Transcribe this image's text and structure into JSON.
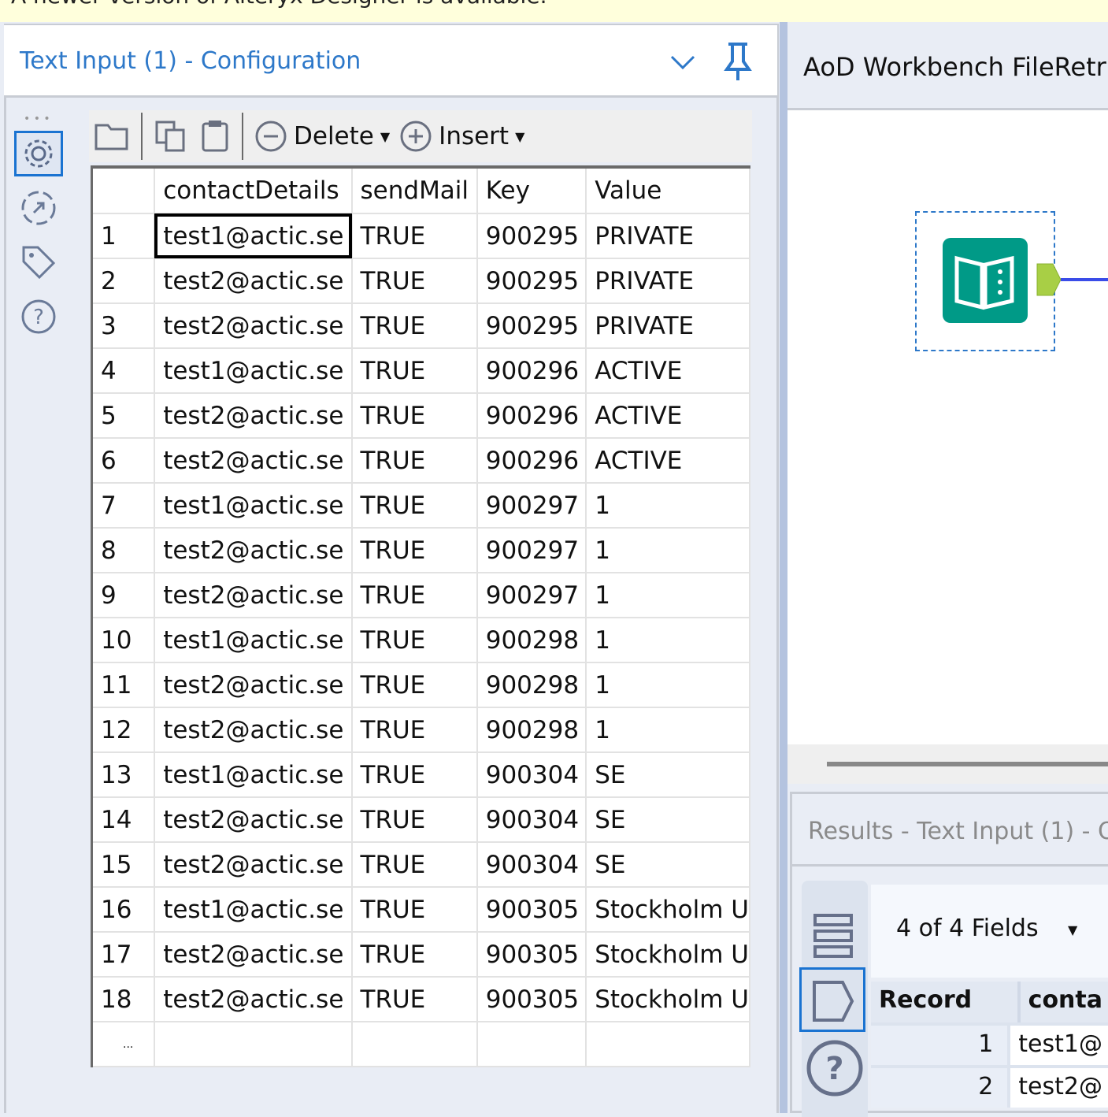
{
  "banner": {
    "text": "A newer version of Alteryx Designer is available."
  },
  "config": {
    "title": "Text Input (1) - Configuration",
    "toolbar": {
      "delete_label": "Delete",
      "insert_label": "Insert"
    },
    "columns": [
      "",
      "contactDetails",
      "sendMail",
      "Key",
      "Value"
    ],
    "rows": [
      [
        "1",
        "test1@actic.se",
        "TRUE",
        "900295",
        "PRIVATE"
      ],
      [
        "2",
        "test2@actic.se",
        "TRUE",
        "900295",
        "PRIVATE"
      ],
      [
        "3",
        "test2@actic.se",
        "TRUE",
        "900295",
        "PRIVATE"
      ],
      [
        "4",
        "test1@actic.se",
        "TRUE",
        "900296",
        "ACTIVE"
      ],
      [
        "5",
        "test2@actic.se",
        "TRUE",
        "900296",
        "ACTIVE"
      ],
      [
        "6",
        "test2@actic.se",
        "TRUE",
        "900296",
        "ACTIVE"
      ],
      [
        "7",
        "test1@actic.se",
        "TRUE",
        "900297",
        "1"
      ],
      [
        "8",
        "test2@actic.se",
        "TRUE",
        "900297",
        "1"
      ],
      [
        "9",
        "test2@actic.se",
        "TRUE",
        "900297",
        "1"
      ],
      [
        "10",
        "test1@actic.se",
        "TRUE",
        "900298",
        "1"
      ],
      [
        "11",
        "test2@actic.se",
        "TRUE",
        "900298",
        "1"
      ],
      [
        "12",
        "test2@actic.se",
        "TRUE",
        "900298",
        "1"
      ],
      [
        "13",
        "test1@actic.se",
        "TRUE",
        "900304",
        "SE"
      ],
      [
        "14",
        "test2@actic.se",
        "TRUE",
        "900304",
        "SE"
      ],
      [
        "15",
        "test2@actic.se",
        "TRUE",
        "900304",
        "SE"
      ],
      [
        "16",
        "test1@actic.se",
        "TRUE",
        "900305",
        "Stockholm U"
      ],
      [
        "17",
        "test2@actic.se",
        "TRUE",
        "900305",
        "Stockholm U"
      ],
      [
        "18",
        "test2@actic.se",
        "TRUE",
        "900305",
        "Stockholm U"
      ]
    ],
    "new_row_marker": "..."
  },
  "workflow": {
    "title": "AoD Workbench FileRetr"
  },
  "results": {
    "title": "Results - Text Input (1) - O",
    "fields_label": "4 of 4 Fields",
    "columns": [
      "Record",
      "conta"
    ],
    "rows": [
      [
        "1",
        "test1@"
      ],
      [
        "2",
        "test2@"
      ]
    ]
  }
}
